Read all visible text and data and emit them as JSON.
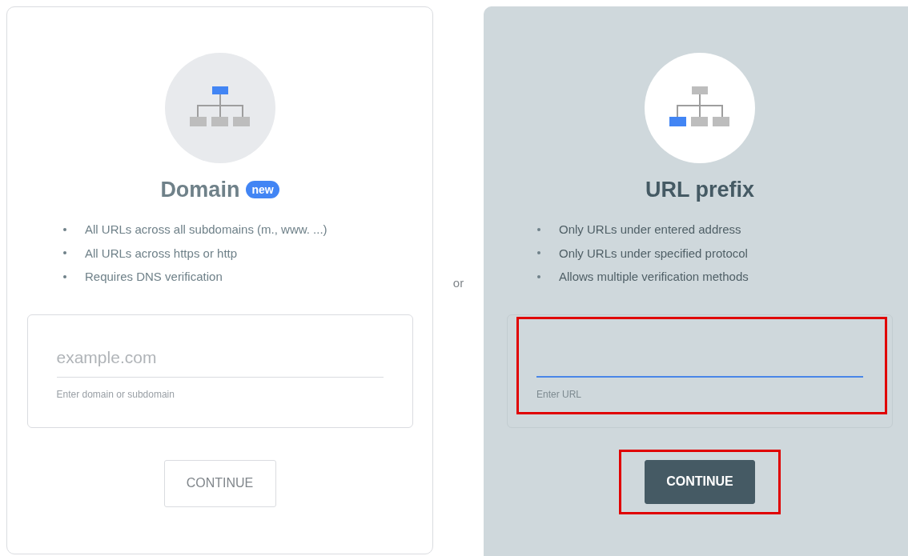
{
  "options": [
    {
      "kind": "domain",
      "selected": false,
      "title": "Domain",
      "badge": "new",
      "bullets": [
        "All URLs across all subdomains (m., www. ...)",
        "All URLs across https or http",
        "Requires DNS verification"
      ],
      "field": {
        "placeholder": "example.com",
        "helper": "Enter domain or subdomain",
        "focused": false,
        "highlighted": false
      },
      "button": {
        "label": "CONTINUE",
        "disabled": true,
        "highlighted": false
      }
    },
    {
      "kind": "url",
      "selected": true,
      "title": "URL prefix",
      "bullets": [
        "Only URLs under entered address",
        "Only URLs under specified protocol",
        "Allows multiple verification methods"
      ],
      "field": {
        "helper": "Enter URL",
        "focused": true,
        "highlighted": true
      },
      "button": {
        "label": "CONTINUE",
        "disabled": false,
        "highlighted": true
      }
    }
  ],
  "separator": "or"
}
